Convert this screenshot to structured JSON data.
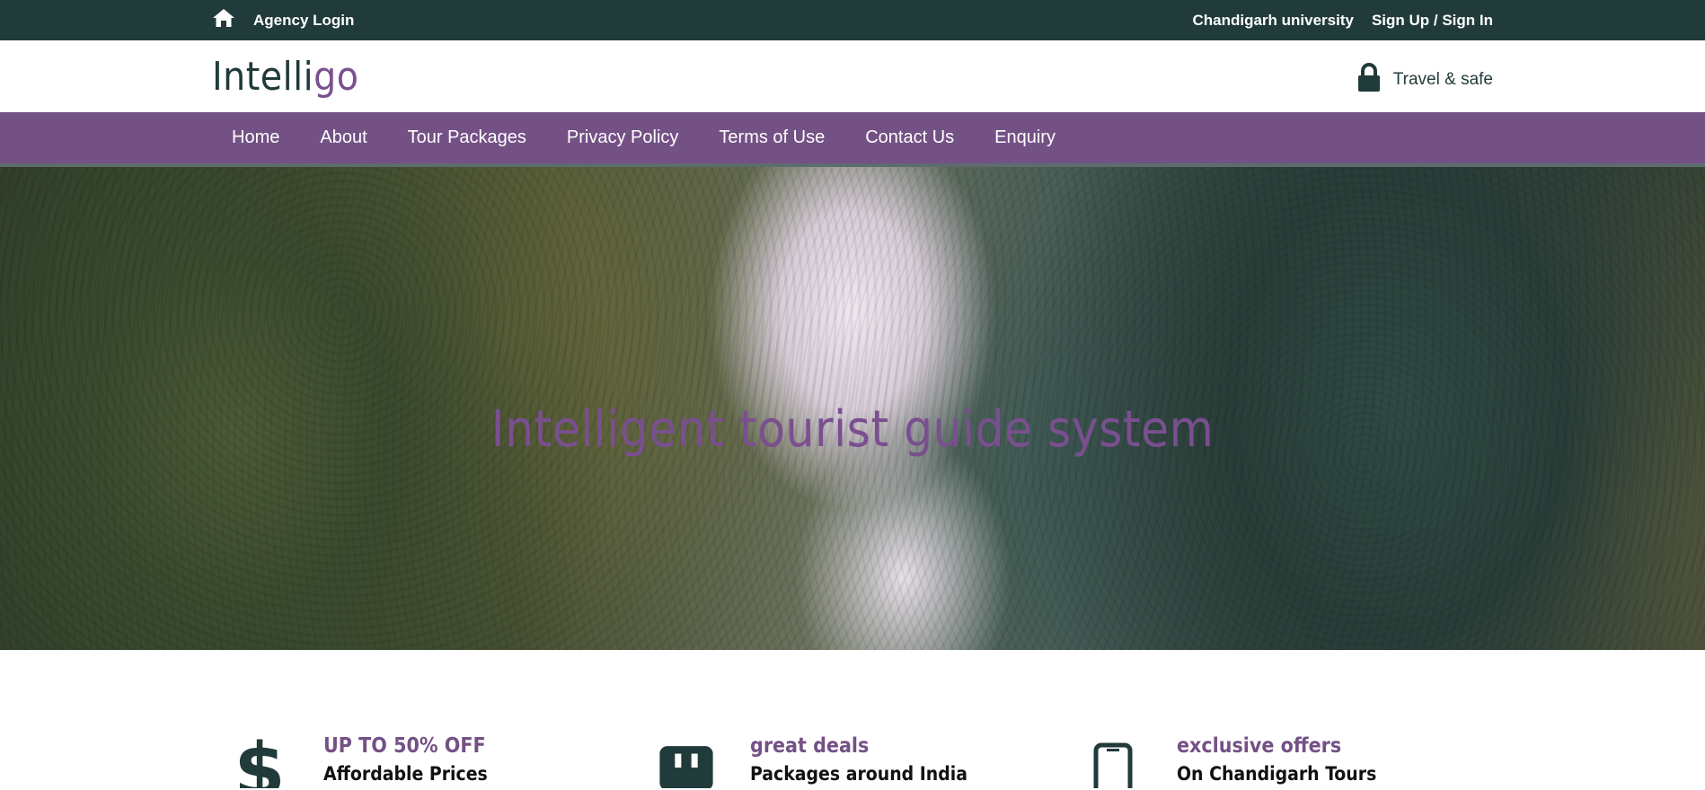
{
  "topbar": {
    "agency_login": "Agency Login",
    "university": "Chandigarh university",
    "signup": "Sign Up / Sign In"
  },
  "header": {
    "logo_main": "Intelli",
    "logo_accent": "go",
    "secure_text": "Travel & safe"
  },
  "nav": {
    "items": [
      {
        "label": "Home"
      },
      {
        "label": "About"
      },
      {
        "label": "Tour Packages"
      },
      {
        "label": "Privacy Policy"
      },
      {
        "label": "Terms of Use"
      },
      {
        "label": "Contact Us"
      },
      {
        "label": "Enquiry"
      }
    ]
  },
  "hero": {
    "title": "Intelligent tourist guide system"
  },
  "features": [
    {
      "icon": "dollar-icon",
      "title": "UP TO 50% OFF",
      "subtitle": "Affordable Prices"
    },
    {
      "icon": "briefcase-icon",
      "title": "great deals",
      "subtitle": "Packages around India"
    },
    {
      "icon": "mobile-icon",
      "title": "exclusive offers",
      "subtitle": "On Chandigarh Tours"
    }
  ],
  "colors": {
    "topbar": "#213a3a",
    "nav": "#745185",
    "accent": "#7a4f8f"
  }
}
